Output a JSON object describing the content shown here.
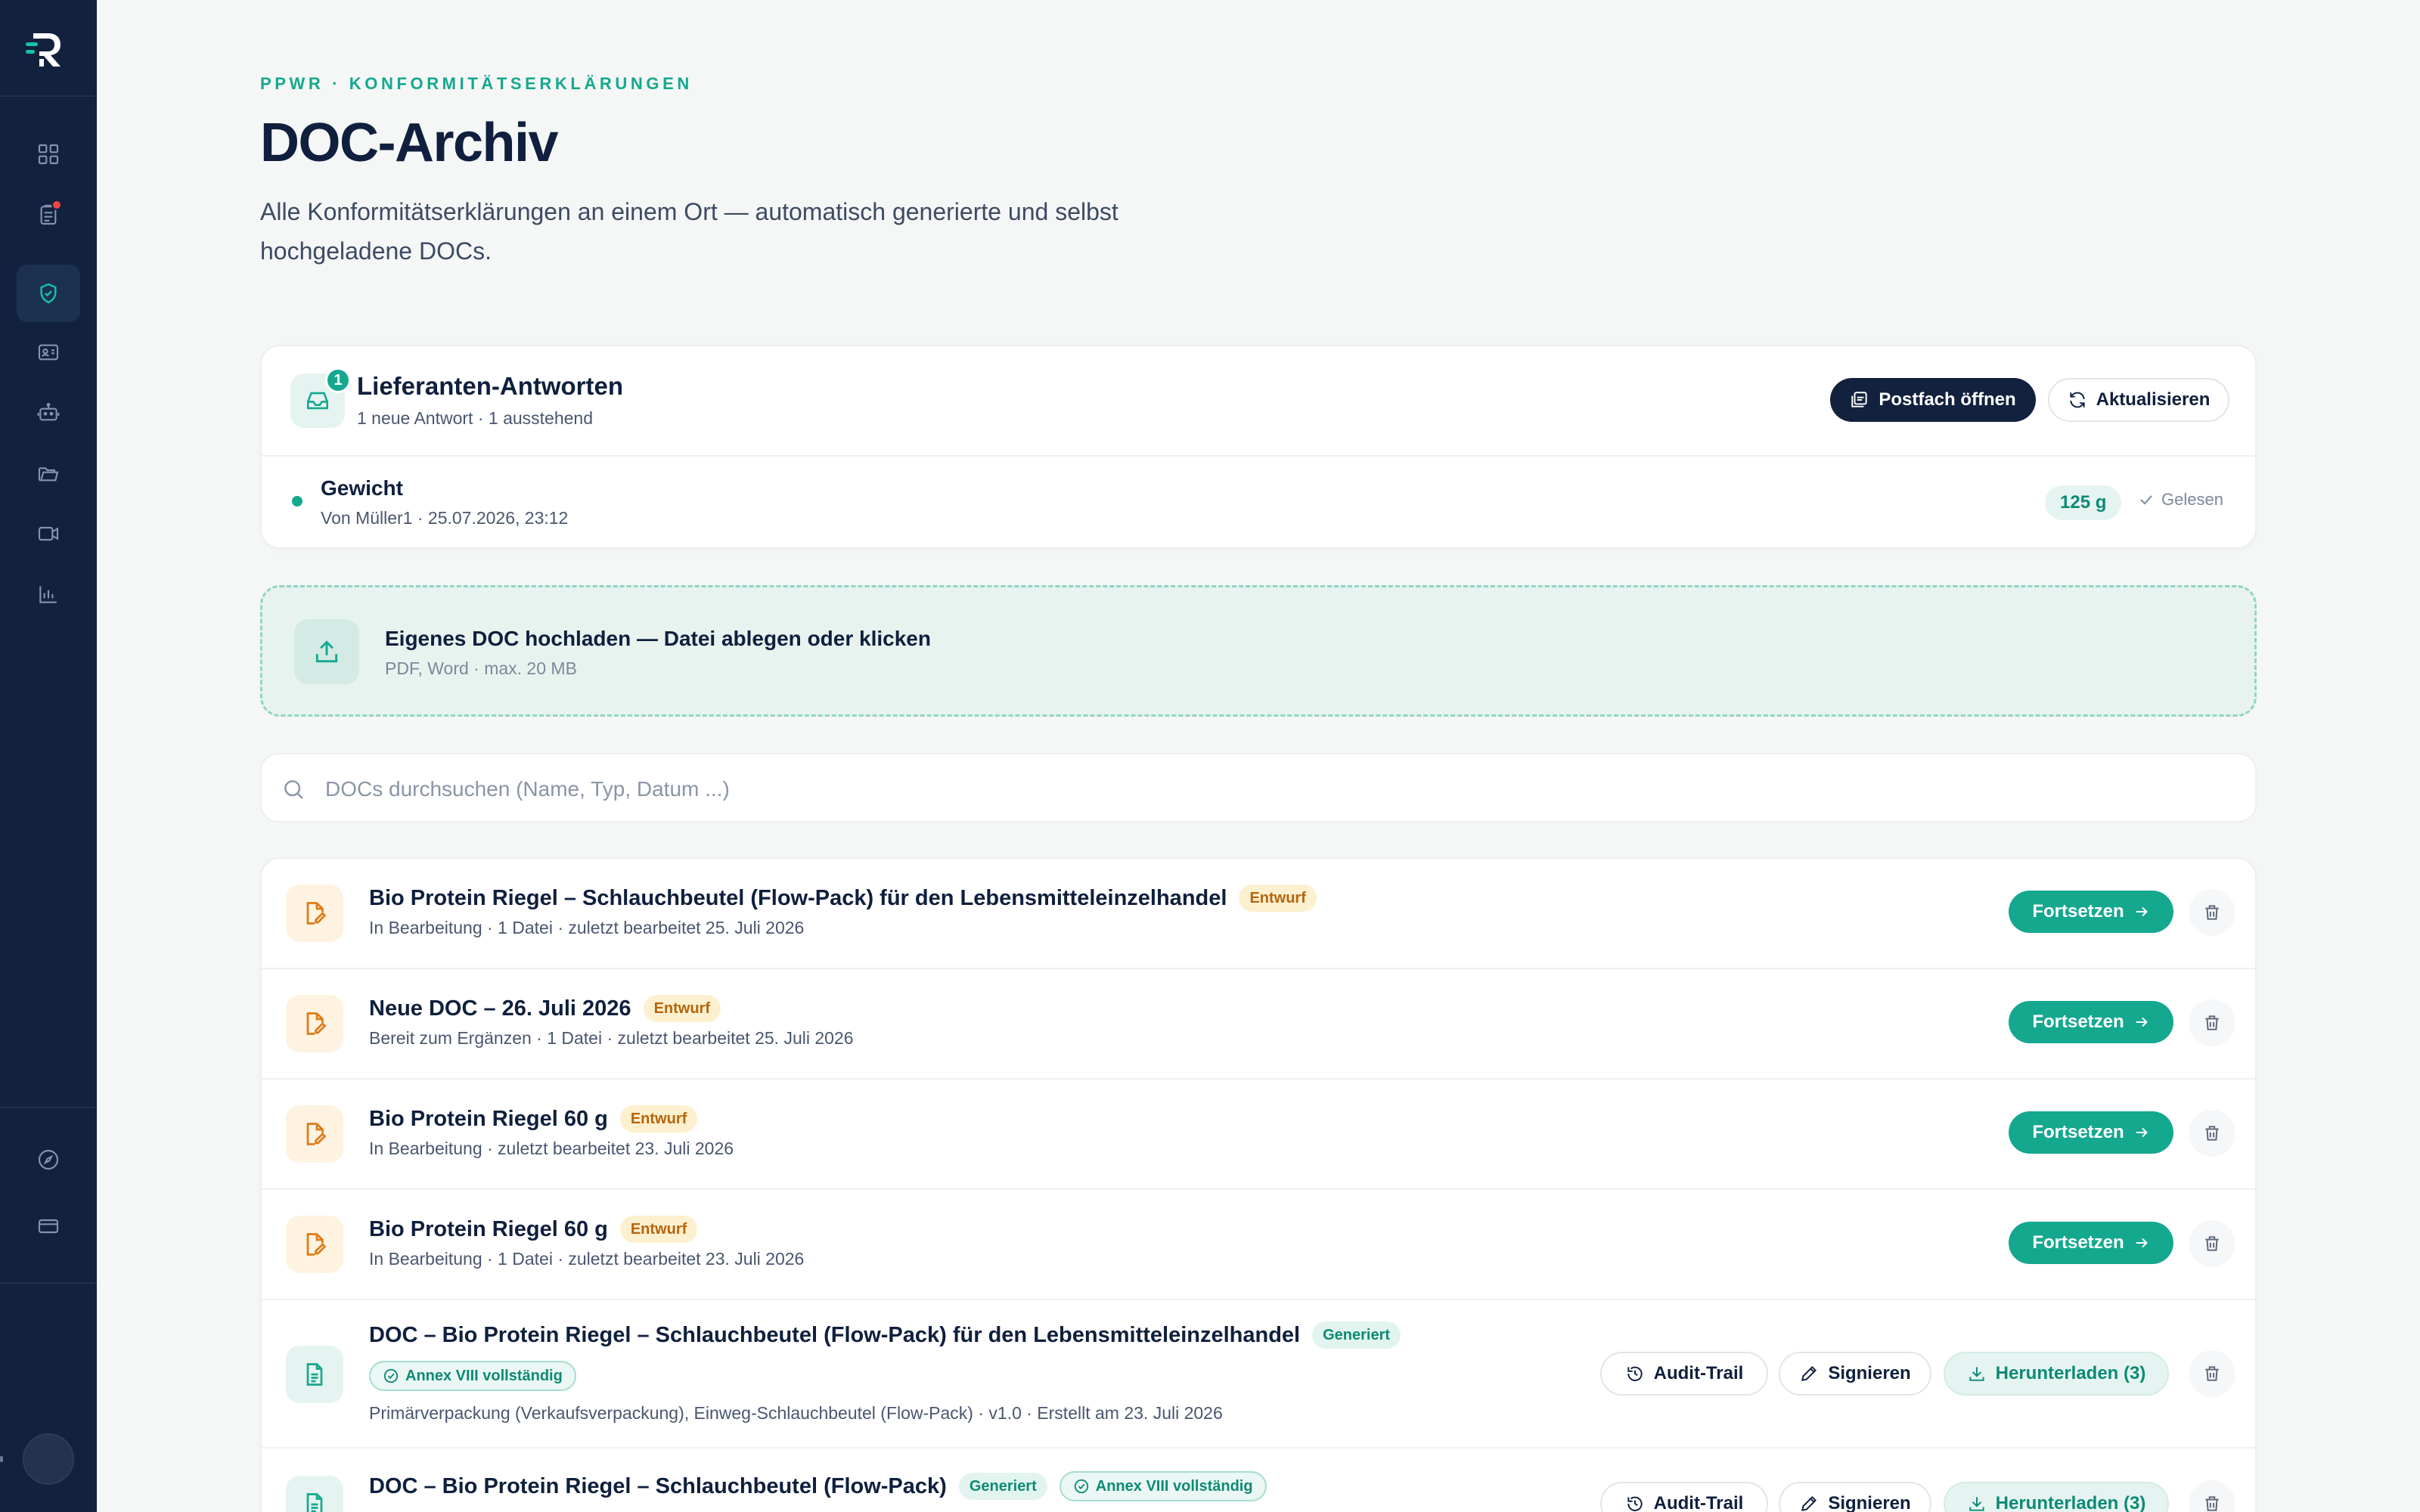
{
  "colors": {
    "sidebar": "#12213d",
    "accent": "#14a88f",
    "draft_badge": "#fdf0cf",
    "notification": "#ef4444"
  },
  "sidebar": {
    "items": [
      {
        "icon": "dashboard-icon"
      },
      {
        "icon": "clipboard-icon",
        "has_notification": true
      },
      {
        "icon": "shield-check-icon",
        "active": true
      },
      {
        "icon": "id-card-icon"
      },
      {
        "icon": "robot-icon"
      },
      {
        "icon": "folder-icon"
      },
      {
        "icon": "video-icon"
      },
      {
        "icon": "bar-chart-icon"
      }
    ],
    "bottom_items": [
      {
        "icon": "compass-icon"
      },
      {
        "icon": "credit-card-icon"
      }
    ]
  },
  "header": {
    "kicker": "PPWR · KONFORMITÄTSERKLÄRUNGEN",
    "title": "DOC-Archiv",
    "subtitle": "Alle Konformitätserklärungen an einem Ort — automatisch generierte und selbst hochgeladene DOCs."
  },
  "supplier": {
    "badge_count": "1",
    "title": "Lieferanten-Antworten",
    "subtitle": "1 neue Antwort · 1 ausstehend",
    "open_inbox_label": "Postfach öffnen",
    "refresh_label": "Aktualisieren",
    "response": {
      "title": "Gewicht",
      "meta": "Von Müller1 · 25.07.2026, 23:12",
      "value": "125 g",
      "status": "Gelesen"
    }
  },
  "upload": {
    "title": "Eigenes DOC hochladen — Datei ablegen oder klicken",
    "hint": "PDF, Word · max. 20 MB"
  },
  "search": {
    "placeholder": "DOCs durchsuchen (Name, Typ, Datum ...)",
    "value": ""
  },
  "docs": [
    {
      "title": "Bio Protein Riegel – Schlauchbeutel (Flow-Pack) für den Lebensmitteleinzelhandel",
      "badge": "Entwurf",
      "meta": "In Bearbeitung · 1 Datei · zuletzt bearbeitet 25. Juli 2026",
      "action": "Fortsetzen"
    },
    {
      "title": "Neue DOC – 26. Juli 2026",
      "badge": "Entwurf",
      "meta": "Bereit zum Ergänzen · 1 Datei · zuletzt bearbeitet 25. Juli 2026",
      "action": "Fortsetzen"
    },
    {
      "title": "Bio Protein Riegel 60 g",
      "badge": "Entwurf",
      "meta": "In Bearbeitung · zuletzt bearbeitet 23. Juli 2026",
      "action": "Fortsetzen"
    },
    {
      "title": "Bio Protein Riegel 60 g",
      "badge": "Entwurf",
      "meta": "In Bearbeitung · 1 Datei · zuletzt bearbeitet 23. Juli 2026",
      "action": "Fortsetzen"
    },
    {
      "title": "DOC – Bio Protein Riegel – Schlauchbeutel (Flow-Pack) für den Lebensmitteleinzelhandel",
      "badge": "Generiert",
      "annex": "Annex VIII vollständig",
      "meta": "Primärverpackung (Verkaufsverpackung), Einweg-Schlauchbeutel (Flow-Pack) · v1.0 · Erstellt am 23. Juli 2026",
      "audit_label": "Audit-Trail",
      "sign_label": "Signieren",
      "download_label": "Herunterladen (3)"
    },
    {
      "title": "DOC – Bio Protein Riegel – Schlauchbeutel (Flow-Pack)",
      "badge": "Generiert",
      "annex": "Annex VIII vollständig",
      "meta": "",
      "audit_label": "Audit-Trail",
      "sign_label": "Signieren",
      "download_label": "Herunterladen (3)"
    }
  ]
}
